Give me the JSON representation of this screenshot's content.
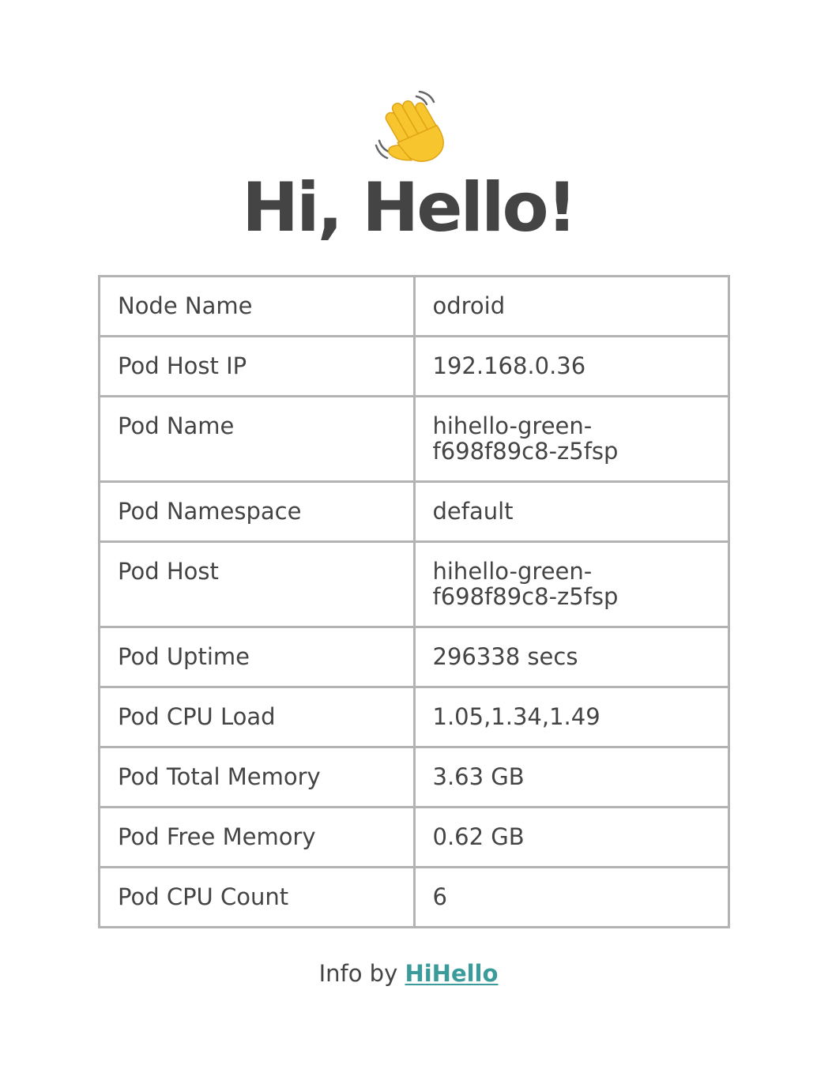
{
  "header": {
    "icon": "waving-hand-icon",
    "title": "Hi, Hello!"
  },
  "info_table": {
    "rows": [
      {
        "key": "Node Name",
        "value": "odroid"
      },
      {
        "key": "Pod Host IP",
        "value": "192.168.0.36"
      },
      {
        "key": "Pod Name",
        "value": "hihello-green-f698f89c8-z5fsp"
      },
      {
        "key": "Pod Namespace",
        "value": "default"
      },
      {
        "key": "Pod Host",
        "value": "hihello-green-f698f89c8-z5fsp"
      },
      {
        "key": "Pod Uptime",
        "value": "296338 secs"
      },
      {
        "key": "Pod CPU Load",
        "value": "1.05,1.34,1.49"
      },
      {
        "key": "Pod Total Memory",
        "value": "3.63 GB"
      },
      {
        "key": "Pod Free Memory",
        "value": "0.62 GB"
      },
      {
        "key": "Pod CPU Count",
        "value": "6"
      }
    ]
  },
  "footer": {
    "prefix": "Info by ",
    "link_label": "HiHello"
  },
  "colors": {
    "text": "#444444",
    "border": "#b3b3b3",
    "link": "#3b9b9b"
  }
}
